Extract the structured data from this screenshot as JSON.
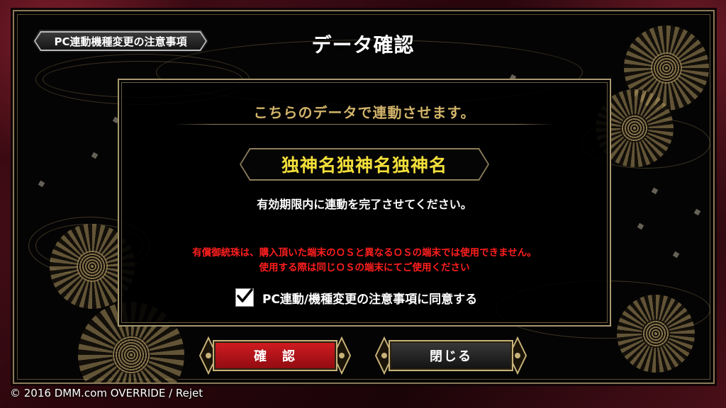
{
  "header": {
    "notice_tag": "PC連動機種変更の注意事項",
    "title": "データ確認"
  },
  "dialog": {
    "heading": "こちらのデータで連動させます。",
    "character_name": "独神名独神名独神名",
    "deadline_text": "有効期限内に連動を完了させてください。",
    "warning_line1": "有償御統珠は、購入頂いた端末のＯＳと異なるＯＳの端末では使用できません。",
    "warning_line2": "使用する際は同じＯＳの端末にてご使用ください",
    "agree_label": "PC連動/機種変更の注意事項に同意する",
    "agree_checked": true
  },
  "buttons": {
    "confirm_label": "確　認",
    "close_label": "閉じる"
  },
  "footer": {
    "copyright": "© 2016 DMM.com OVERRIDE / Rejet"
  },
  "colors": {
    "heading_gold": "#d2b46a",
    "name_yellow": "#f3e03a",
    "warning_red": "#ff1e1e",
    "confirm_red": "#c4151b",
    "frame_gold": "#a89870"
  }
}
